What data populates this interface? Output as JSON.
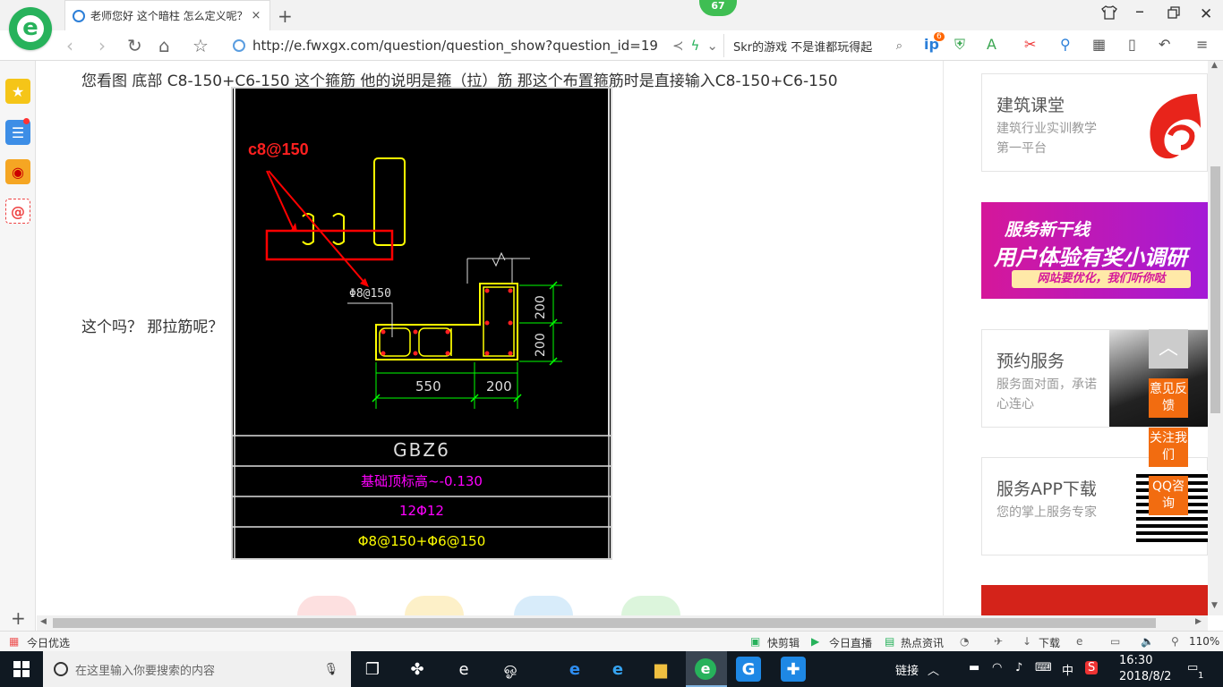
{
  "browser": {
    "badge_count": "67",
    "tab_title": "老师您好 这个暗柱 怎么定义呢？",
    "tab_close": "×",
    "new_tab": "+",
    "address": "http://e.fwxgx.com/question/question_show?question_id=19",
    "search_text": "Skr的游戏 不是谁都玩得起",
    "tool_badge": "6"
  },
  "question": {
    "line1": "您看图 底部   C8-150+C6-150  这个箍筋   他的说明是箍（拉）筋   那这个布置箍筋时是直接输入C8-150+C6-150",
    "line2": "这个吗？ 那拉筋呢？"
  },
  "cad": {
    "red_label": "c8@150",
    "rebar_label": "Φ8@150",
    "dim_200_top": "200",
    "dim_200_bottom": "200",
    "dim_550": "550",
    "dim_200_width": "200",
    "table_name": "GBZ6",
    "table_elev": "基础顶标高~-0.130",
    "table_long": "12Φ12",
    "table_stirrup": "Φ8@150+Φ6@150"
  },
  "sidebar_right": {
    "card1_title": "建筑课堂",
    "card1_sub": "建筑行业实训教学第一平台",
    "banner_top": "服务新干线",
    "banner_main": "用户体验有奖小调研",
    "banner_sub": "网站要优化，我们听你哒",
    "card2_title": "预约服务",
    "card2_sub": "服务面对面，承诺心连心",
    "card3_title": "服务APP下载",
    "card3_sub": "您的掌上服务专家"
  },
  "float_buttons": {
    "feedback": "意见反馈",
    "follow": "关注我们",
    "qq": "QQ咨询"
  },
  "statusbar": {
    "left": "今日优选",
    "kuaijianji": "快剪辑",
    "live": "今日直播",
    "news": "热点资讯",
    "download": "下载",
    "zoom": "110%"
  },
  "taskbar": {
    "search_placeholder": "在这里输入你要搜索的内容",
    "link": "链接",
    "ime": "中",
    "time": "16:30",
    "date": "2018/8/2",
    "notif": "1"
  },
  "colors": {
    "accent_green": "#27b25b",
    "float_orange": "#f26c10",
    "cad_yellow": "#ffff00",
    "cad_green": "#00ff00",
    "cad_magenta": "#ff00ff",
    "annotation_red": "#ff0000"
  }
}
